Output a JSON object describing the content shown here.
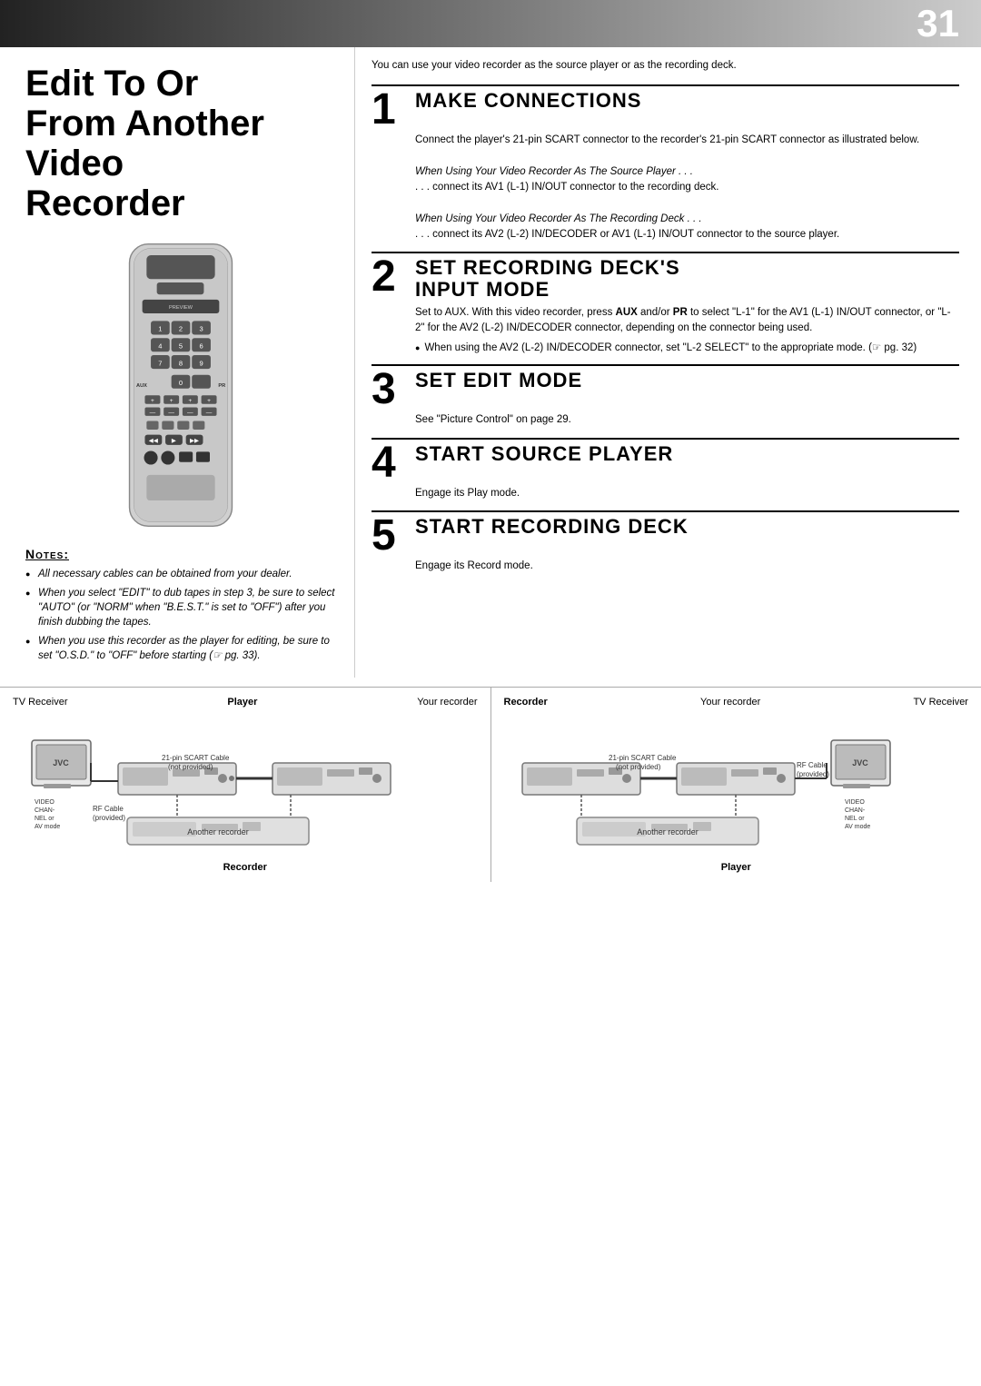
{
  "page": {
    "number": "31",
    "title": "Edit To Or\nFrom Another\nVideo\nRecorder"
  },
  "intro": {
    "text": "You can use your video recorder as the source player or as the recording deck."
  },
  "steps": [
    {
      "number": "1",
      "title": "Make Connections",
      "content": "Connect the player's 21-pin SCART connector to the recorder's 21-pin SCART connector as illustrated below.",
      "sub1_title": "When Using Your Video Recorder As The Source Player . . .",
      "sub1_text": ". . . connect its AV1 (L-1) IN/OUT connector to the recording deck.",
      "sub2_title": "When Using Your Video Recorder As The Recording Deck . . .",
      "sub2_text": ". . . connect its AV2 (L-2) IN/DECODER or AV1 (L-1) IN/OUT connector to the source player."
    },
    {
      "number": "2",
      "title": "Set Recording Deck's\nInput Mode",
      "content": "Set to AUX. With this video recorder, press AUX and/or PR to select \"L-1\" for the AV1 (L-1) IN/OUT connector, or \"L-2\" for the AV2 (L-2) IN/DECODER connector, depending on the connector being used.",
      "bullet": "When using the AV2 (L-2) IN/DECODER connector, set \"L-2 SELECT\" to the appropriate mode. (☞ pg. 32)"
    },
    {
      "number": "3",
      "title": "Set Edit Mode",
      "content": "See \"Picture Control\" on page 29."
    },
    {
      "number": "4",
      "title": "Start Source Player",
      "content": "Engage its Play mode."
    },
    {
      "number": "5",
      "title": "Start Recording Deck",
      "content": "Engage its Record mode."
    }
  ],
  "notes": {
    "title": "Notes:",
    "items": [
      "All necessary cables can be obtained from your dealer.",
      "When you select \"EDIT\" to dub tapes in step 3, be sure to select \"AUTO\" (or \"NORM\" when \"B.E.S.T.\" is set to \"OFF\") after you finish dubbing the tapes.",
      "When you use this recorder as the player for editing, be sure to set \"O.S.D.\" to \"OFF\" before starting (☞ pg. 33)."
    ]
  },
  "diagrams": [
    {
      "id": "left",
      "label_left": "TV Receiver",
      "label_player": "Player",
      "label_your_recorder": "Your recorder",
      "cable1": "21-pin SCART Cable\n(not provided)",
      "cable2": "RF Cable\n(provided)",
      "video_chan": "VIDEO\nCHAN-\nNEL or\nAV mode",
      "another_recorder": "Another recorder",
      "bottom_label": "Recorder"
    },
    {
      "id": "right",
      "label_recorder": "Recorder",
      "label_your_recorder": "Your recorder",
      "label_tv": "TV Receiver",
      "cable1": "21-pin SCART Cable\n(not provided)",
      "cable2": "RF Cable\n(provided)",
      "video_chan": "VIDEO\nCHAN-\nNEL or\nAV mode",
      "another_recorder": "Another recorder",
      "bottom_label": "Player"
    }
  ]
}
